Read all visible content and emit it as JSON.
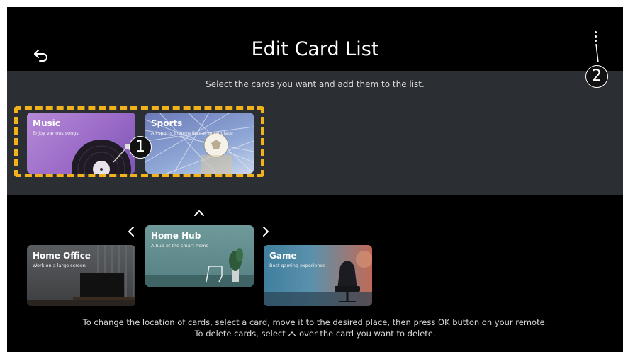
{
  "header": {
    "title": "Edit Card List"
  },
  "callouts": {
    "one": "1",
    "two": "2"
  },
  "select_panel": {
    "instruction": "Select the cards you want and add them to the list.",
    "cards": [
      {
        "title": "Music",
        "desc": "Enjoy various songs"
      },
      {
        "title": "Sports",
        "desc": "All sports information at once place"
      }
    ]
  },
  "list": {
    "cards": [
      {
        "title": "Home Office",
        "desc": "Work on a large screen"
      },
      {
        "title": "Home Hub",
        "desc": "A hub of the smart home"
      },
      {
        "title": "Game",
        "desc": "Best gaming experience"
      }
    ]
  },
  "footer": {
    "line1": "To change the location of cards, select a card, move it to the desired place, then press OK button on your remote.",
    "line2_before": "To delete cards, select",
    "line2_after": "over the card you want to delete."
  },
  "colors": {
    "highlight": "#f2b21c",
    "panel": "#2b2e33",
    "background": "#000000"
  }
}
